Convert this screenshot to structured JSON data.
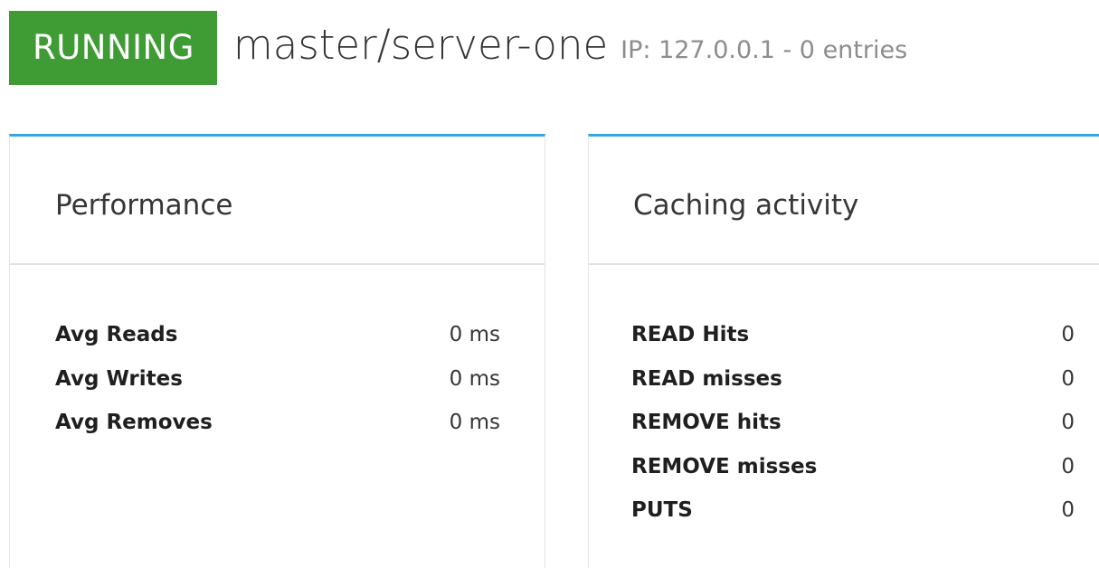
{
  "header": {
    "status": "RUNNING",
    "server_name": "master/server-one",
    "meta": "IP: 127.0.0.1 - 0 entries"
  },
  "colors": {
    "status_running": "#3f9c35",
    "card_accent": "#39a5dc"
  },
  "performance": {
    "title": "Performance",
    "rows": [
      {
        "label": "Avg Reads",
        "value": "0 ms"
      },
      {
        "label": "Avg Writes",
        "value": "0 ms"
      },
      {
        "label": "Avg Removes",
        "value": "0 ms"
      }
    ]
  },
  "caching": {
    "title": "Caching activity",
    "rows": [
      {
        "label": "READ Hits",
        "value": "0"
      },
      {
        "label": "READ misses",
        "value": "0"
      },
      {
        "label": "REMOVE hits",
        "value": "0"
      },
      {
        "label": "REMOVE misses",
        "value": "0"
      },
      {
        "label": "PUTS",
        "value": "0"
      }
    ]
  }
}
